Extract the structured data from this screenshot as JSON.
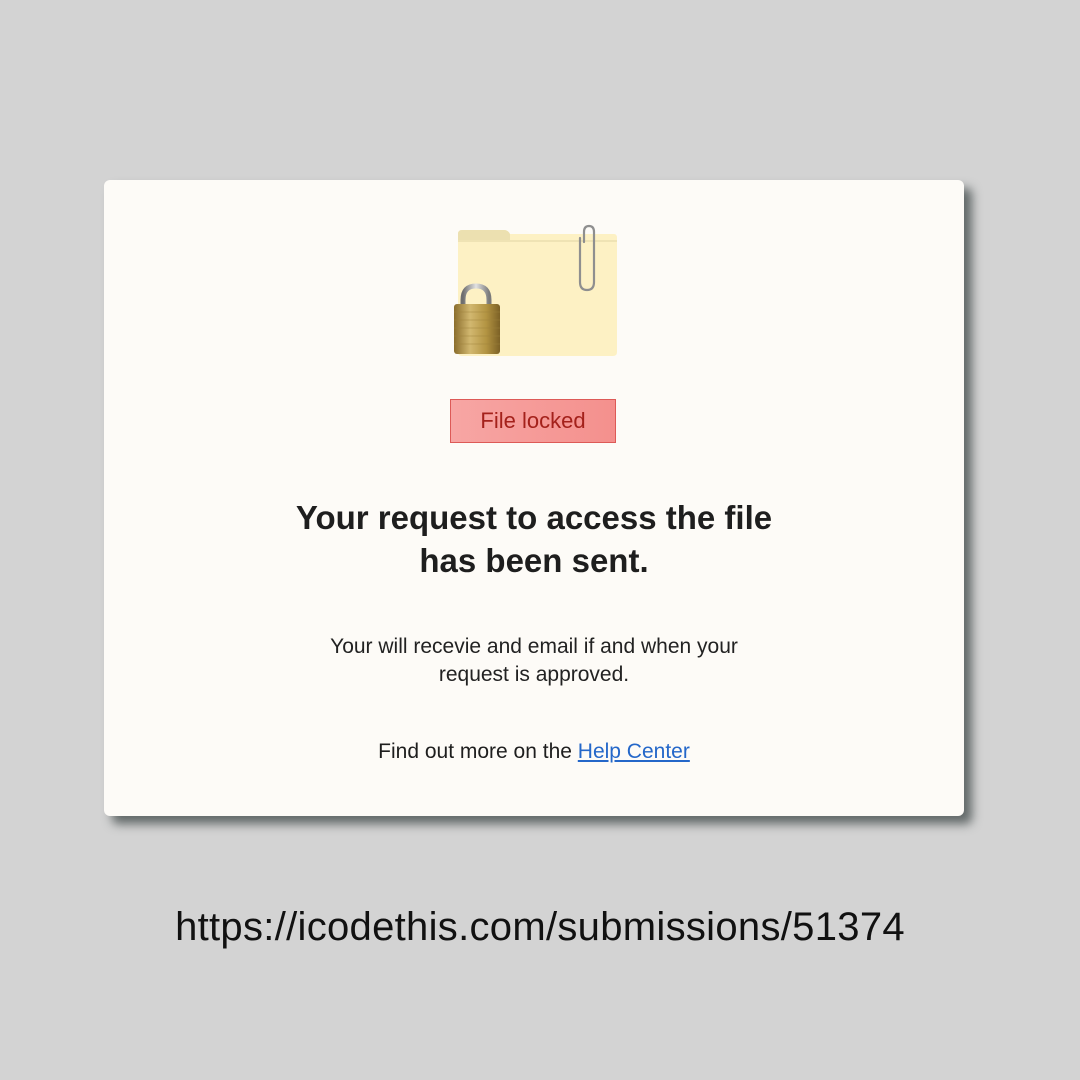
{
  "card": {
    "status_badge": "File locked",
    "title_lines": [
      "Your request to access the file",
      "has been sent."
    ],
    "description_lines": [
      "Your will recevie and email if and when your",
      "request is approved."
    ],
    "help_prefix": "Find out more on the ",
    "help_link": "Help Center"
  },
  "icons": {
    "illustration": "locked-folder-icon",
    "folder": "folder-icon",
    "paperclip": "paperclip-icon",
    "padlock": "padlock-icon"
  },
  "colors": {
    "page_background": "#d3d3d3",
    "card_background": "#fdfbf7",
    "badge_background": "#f59c9a",
    "badge_border": "#dd5a57",
    "badge_text": "#a4211b",
    "link": "#2467c9",
    "folder": "#fdf1c4"
  },
  "footer": {
    "url": "https://icodethis.com/submissions/51374"
  }
}
